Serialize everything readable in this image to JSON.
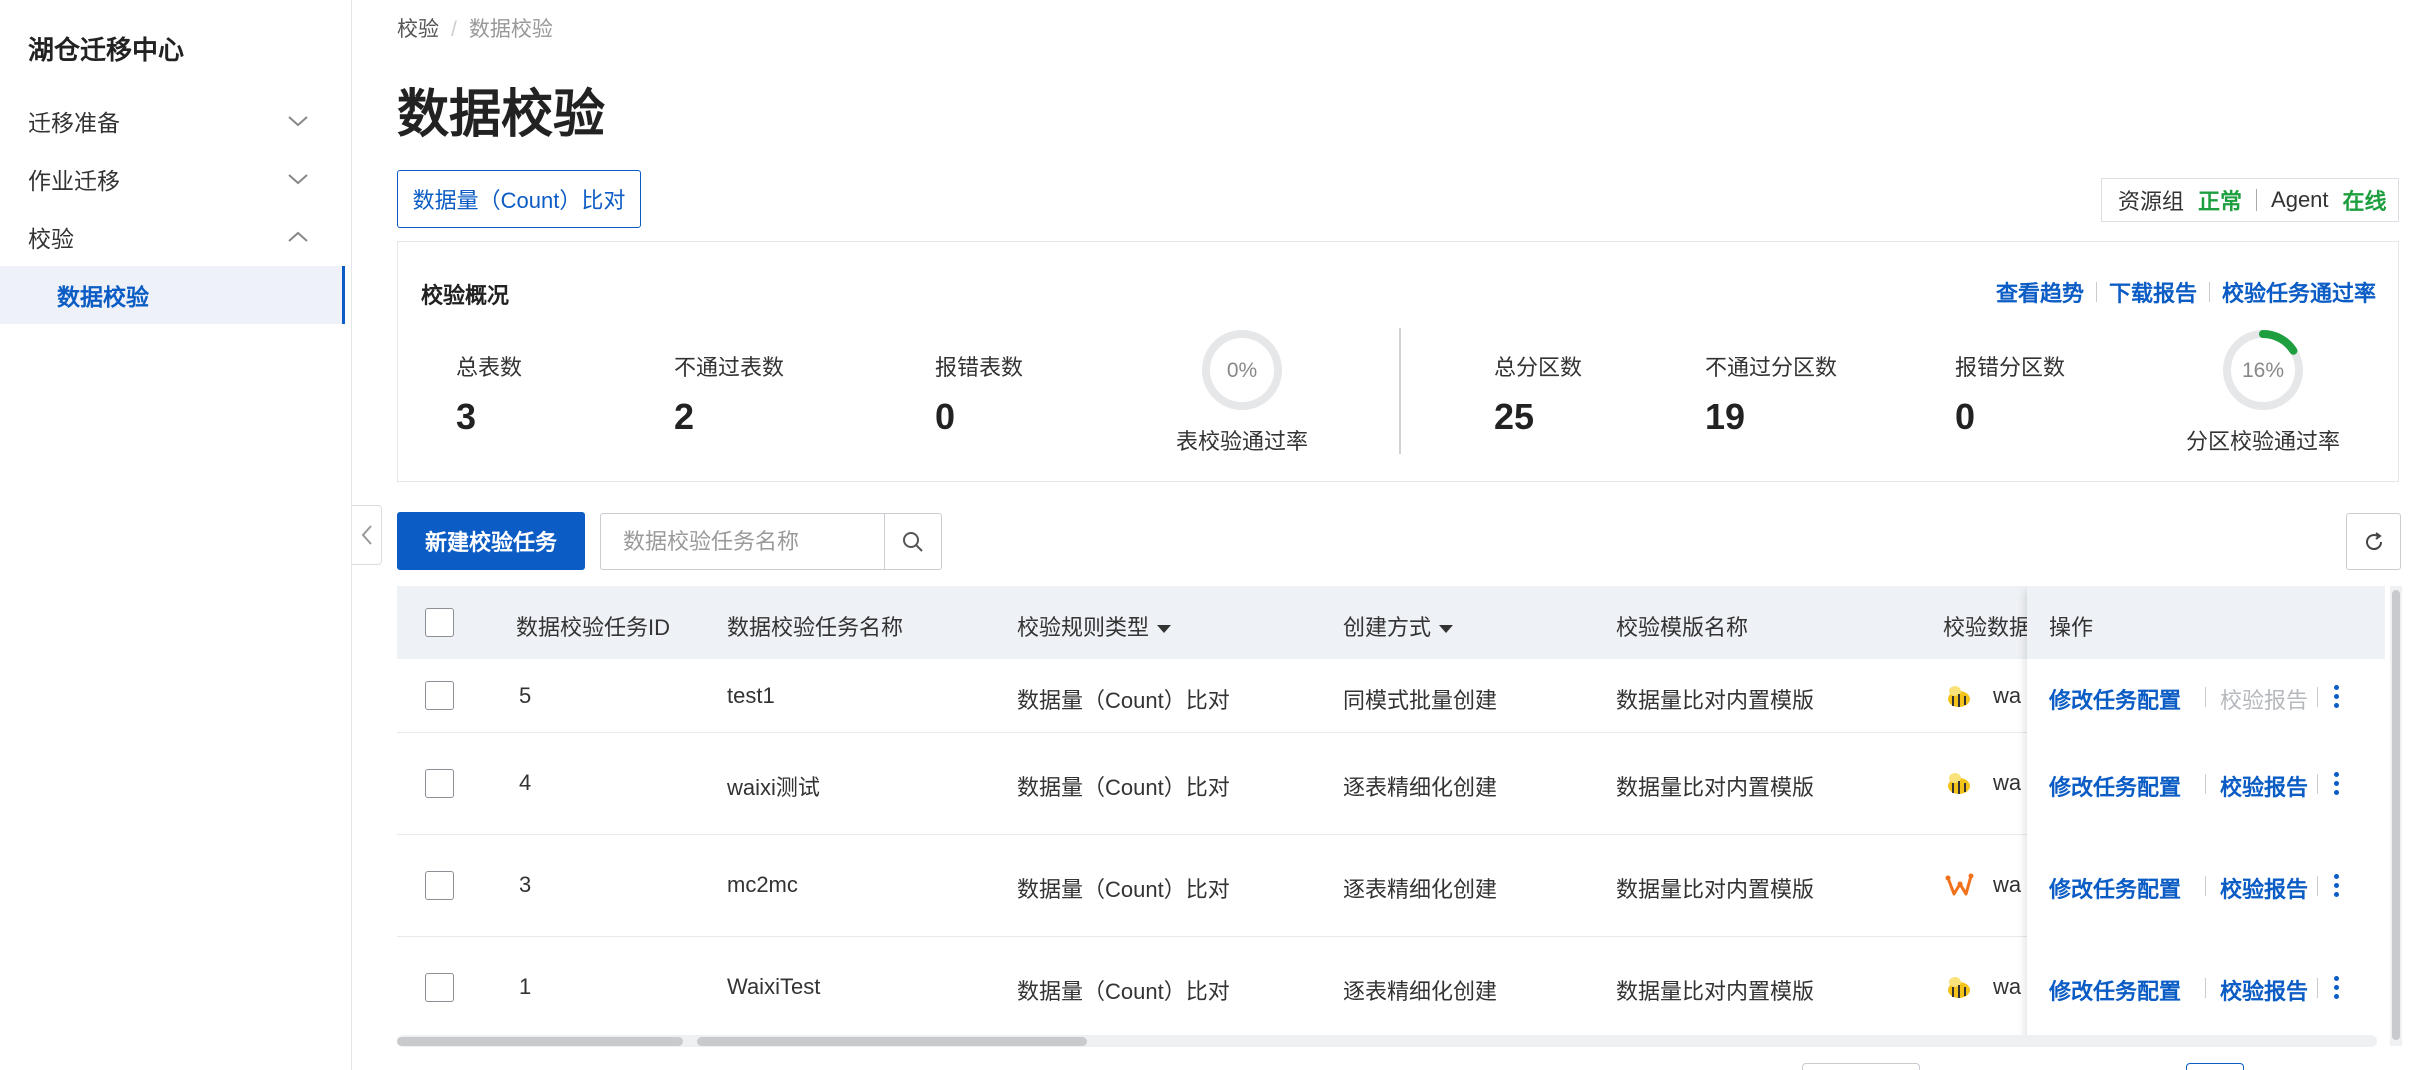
{
  "sidebar": {
    "title": "湖仓迁移中心",
    "items": [
      {
        "label": "迁移准备"
      },
      {
        "label": "作业迁移"
      },
      {
        "label": "校验"
      }
    ],
    "sub_item": "数据校验"
  },
  "breadcrumb": {
    "parent": "校验",
    "sep": "/",
    "current": "数据校验"
  },
  "page_title": "数据校验",
  "type_tab": "数据量（Count）比对",
  "status": {
    "resource_label": "资源组",
    "resource_value": "正常",
    "agent_label": "Agent",
    "agent_value": "在线",
    "ok_color": "#1e9f3f"
  },
  "overview": {
    "title": "校验概况",
    "links": [
      "查看趋势",
      "下载报告",
      "校验任务通过率"
    ],
    "table_stats": [
      {
        "label": "总表数",
        "value": "3"
      },
      {
        "label": "不通过表数",
        "value": "2"
      },
      {
        "label": "报错表数",
        "value": "0"
      }
    ],
    "table_pass": {
      "percent_text": "0%",
      "fraction": 0.0,
      "caption": "表校验通过率"
    },
    "partition_stats": [
      {
        "label": "总分区数",
        "value": "25"
      },
      {
        "label": "不通过分区数",
        "value": "19"
      },
      {
        "label": "报错分区数",
        "value": "0"
      }
    ],
    "partition_pass": {
      "percent_text": "16%",
      "fraction": 0.16,
      "caption": "分区校验通过率"
    },
    "ring_color": "#1e9f3f"
  },
  "toolbar": {
    "new_button": "新建校验任务",
    "search_placeholder": "数据校验任务名称"
  },
  "table": {
    "columns": {
      "id": "数据校验任务ID",
      "name": "数据校验任务名称",
      "rule": "校验规则类型",
      "create": "创建方式",
      "template": "校验模版名称",
      "source": "校验数据",
      "ops": "操作"
    },
    "rows": [
      {
        "id": "5",
        "name": "test1",
        "rule": "数据量（Count）比对",
        "create": "同模式批量创建",
        "template": "数据量比对内置模版",
        "source_icon": "hive-bee-icon",
        "source": "waixi",
        "edit": "修改任务配置",
        "report": "校验报告",
        "report_disabled": true
      },
      {
        "id": "4",
        "name": "waixi测试",
        "rule": "数据量（Count）比对",
        "create": "逐表精细化创建",
        "template": "数据量比对内置模版",
        "source_icon": "hive-bee-icon",
        "source": "waixi",
        "edit": "修改任务配置",
        "report": "校验报告",
        "report_disabled": false
      },
      {
        "id": "3",
        "name": "mc2mc",
        "rule": "数据量（Count）比对",
        "create": "逐表精细化创建",
        "template": "数据量比对内置模版",
        "source_icon": "maxcompute-icon",
        "source": "waixi",
        "edit": "修改任务配置",
        "report": "校验报告",
        "report_disabled": false
      },
      {
        "id": "1",
        "name": "WaixiTest",
        "rule": "数据量（Count）比对",
        "create": "逐表精细化创建",
        "template": "数据量比对内置模版",
        "source_icon": "hive-bee-icon",
        "source": "waixi",
        "edit": "修改任务配置",
        "report": "校验报告",
        "report_disabled": false
      }
    ]
  },
  "colors": {
    "primary": "#0b5cc4"
  }
}
